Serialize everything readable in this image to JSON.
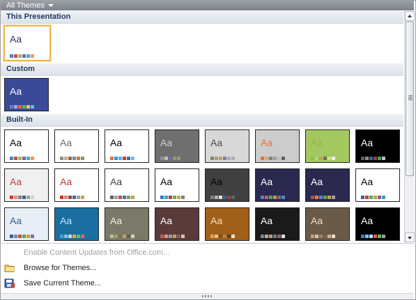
{
  "header": {
    "label": "All Themes"
  },
  "sections": {
    "this_presentation": "This Presentation",
    "custom": "Custom",
    "built_in": "Built-In"
  },
  "commands": [
    {
      "label": "Enable Content Updates from Office.com...",
      "enabled": false
    },
    {
      "label": "Browse for Themes...",
      "enabled": true,
      "icon": "folder-icon"
    },
    {
      "label": "Save Current Theme...",
      "enabled": true,
      "icon": "save-theme-icon"
    }
  ],
  "tiles": {
    "sample_text": "Aa",
    "current": {
      "bg": "#ffffff",
      "fg": "#1e395b",
      "colors": [
        "#4f81bd",
        "#c0504d",
        "#9bbb59",
        "#8064a2",
        "#4bacc6",
        "#f79646"
      ]
    },
    "custom": {
      "bg": "#3a4a98",
      "fg": "#ffffff",
      "colors": [
        "#6a7ac9",
        "#a0a8e0",
        "#e06060",
        "#60b060",
        "#d0d060",
        "#60c0d0"
      ]
    },
    "builtin": [
      {
        "bg": "#ffffff",
        "fg": "#000000",
        "colors": [
          "#4f81bd",
          "#c0504d",
          "#9bbb59",
          "#8064a2",
          "#4bacc6",
          "#f79646"
        ]
      },
      {
        "bg": "#ffffff",
        "fg": "#6b6b5b",
        "colors": [
          "#8c8c7c",
          "#c0b090",
          "#a06050",
          "#7090a0",
          "#c08040",
          "#909060"
        ]
      },
      {
        "bg": "#ffffff",
        "fg": "#000000",
        "colors": [
          "#e8703a",
          "#2c9bd8",
          "#5bb0e0",
          "#c04030",
          "#3a70b0",
          "#70c0e0"
        ]
      },
      {
        "bg": "#6f6f6f",
        "fg": "#d0d0d0",
        "colors": [
          "#9090a0",
          "#c0c0c0",
          "#6070b0",
          "#a09070",
          "#80a080",
          "#707070"
        ]
      },
      {
        "bg": "#d8d8d8",
        "fg": "#4a4a4a",
        "colors": [
          "#7a8a6a",
          "#a0a080",
          "#c0a060",
          "#808090",
          "#a0b0c0",
          "#b0b0b0"
        ]
      },
      {
        "bg": "#cccccc",
        "fg": "#e8703a",
        "colors": [
          "#e8703a",
          "#f0a060",
          "#808080",
          "#a0a0a0",
          "#c0c0c0",
          "#606060"
        ]
      },
      {
        "bg": "#a4c860",
        "fg": "#8fb84a",
        "colors": [
          "#90c050",
          "#b0d080",
          "#c0a060",
          "#707050",
          "#d0e090",
          "#f0f0f0"
        ]
      },
      {
        "bg": "#000000",
        "fg": "#ffffff",
        "colors": [
          "#606060",
          "#909090",
          "#4060a0",
          "#a04040",
          "#40a060",
          "#c0c0c0"
        ]
      },
      {
        "bg": "#f0f0f0",
        "fg": "#c04040",
        "colors": [
          "#c04040",
          "#e09090",
          "#808080",
          "#4060a0",
          "#a0a0a0",
          "#d0d0d0"
        ]
      },
      {
        "bg": "#ffffff",
        "fg": "#c0392b",
        "colors": [
          "#c0392b",
          "#e0826a",
          "#8a4b3c",
          "#4a6a8a",
          "#a0a0a0",
          "#d0a060"
        ]
      },
      {
        "bg": "#ffffff",
        "fg": "#404040",
        "colors": [
          "#606060",
          "#a0a0a0",
          "#c05050",
          "#5070a0",
          "#70a070",
          "#c0a050"
        ]
      },
      {
        "bg": "#ffffff",
        "fg": "#000000",
        "colors": [
          "#2a7fb0",
          "#40a0d0",
          "#c04040",
          "#60b060",
          "#d0a040",
          "#808080"
        ]
      },
      {
        "bg": "#404040",
        "fg": "#000000",
        "colors": [
          "#808080",
          "#b0b0b0",
          "#e0e0e0",
          "#4060a0",
          "#a04040",
          "#606060"
        ]
      },
      {
        "bg": "#2a2a50",
        "fg": "#ffffff",
        "colors": [
          "#6080c0",
          "#c06060",
          "#60a060",
          "#c0a040",
          "#8060a0",
          "#4090b0"
        ]
      },
      {
        "bg": "#2a2a50",
        "fg": "#ffffff",
        "colors": [
          "#c05030",
          "#e08050",
          "#6080c0",
          "#60a060",
          "#c0a040",
          "#a0a0a0"
        ]
      },
      {
        "bg": "#ffffff",
        "fg": "#000000",
        "colors": [
          "#4060a0",
          "#c04040",
          "#60a060",
          "#c0a040",
          "#8060a0",
          "#40a0c0"
        ]
      },
      {
        "bg": "#e8eef5",
        "fg": "#3a5a8a",
        "colors": [
          "#3a5a8a",
          "#6a8aba",
          "#c05050",
          "#60a060",
          "#c0a040",
          "#8a6aa0"
        ]
      },
      {
        "bg": "#1a6fa0",
        "fg": "#bfe6ff",
        "colors": [
          "#40a0d0",
          "#80c0e0",
          "#c0e0f0",
          "#f0a040",
          "#60c060",
          "#e06060"
        ]
      },
      {
        "bg": "#7a7a6a",
        "fg": "#f0f0e0",
        "colors": [
          "#c0c090",
          "#a0a070",
          "#807050",
          "#c0a060",
          "#606050",
          "#e0d0a0"
        ]
      },
      {
        "bg": "#5a3a3a",
        "fg": "#ffffff",
        "colors": [
          "#c06050",
          "#e09080",
          "#a0a0a0",
          "#c0a060",
          "#806060",
          "#e0c0a0"
        ]
      },
      {
        "bg": "#a0601a",
        "fg": "#ffe0b0",
        "colors": [
          "#e0a050",
          "#f0c080",
          "#805020",
          "#c08040",
          "#604020",
          "#f0e0c0"
        ]
      },
      {
        "bg": "#1a1a1a",
        "fg": "#ffffff",
        "colors": [
          "#808080",
          "#b0b0b0",
          "#c0a060",
          "#6080a0",
          "#a06060",
          "#e0e0e0"
        ]
      },
      {
        "bg": "#6a5a4a",
        "fg": "#f0e0d0",
        "colors": [
          "#c0a080",
          "#e0c0a0",
          "#a08060",
          "#806050",
          "#d0b090",
          "#f0e0c0"
        ]
      },
      {
        "bg": "#000000",
        "fg": "#ffffff",
        "colors": [
          "#4080c0",
          "#80c0f0",
          "#c0e0ff",
          "#e06040",
          "#60c060",
          "#a0a0a0"
        ]
      }
    ]
  }
}
